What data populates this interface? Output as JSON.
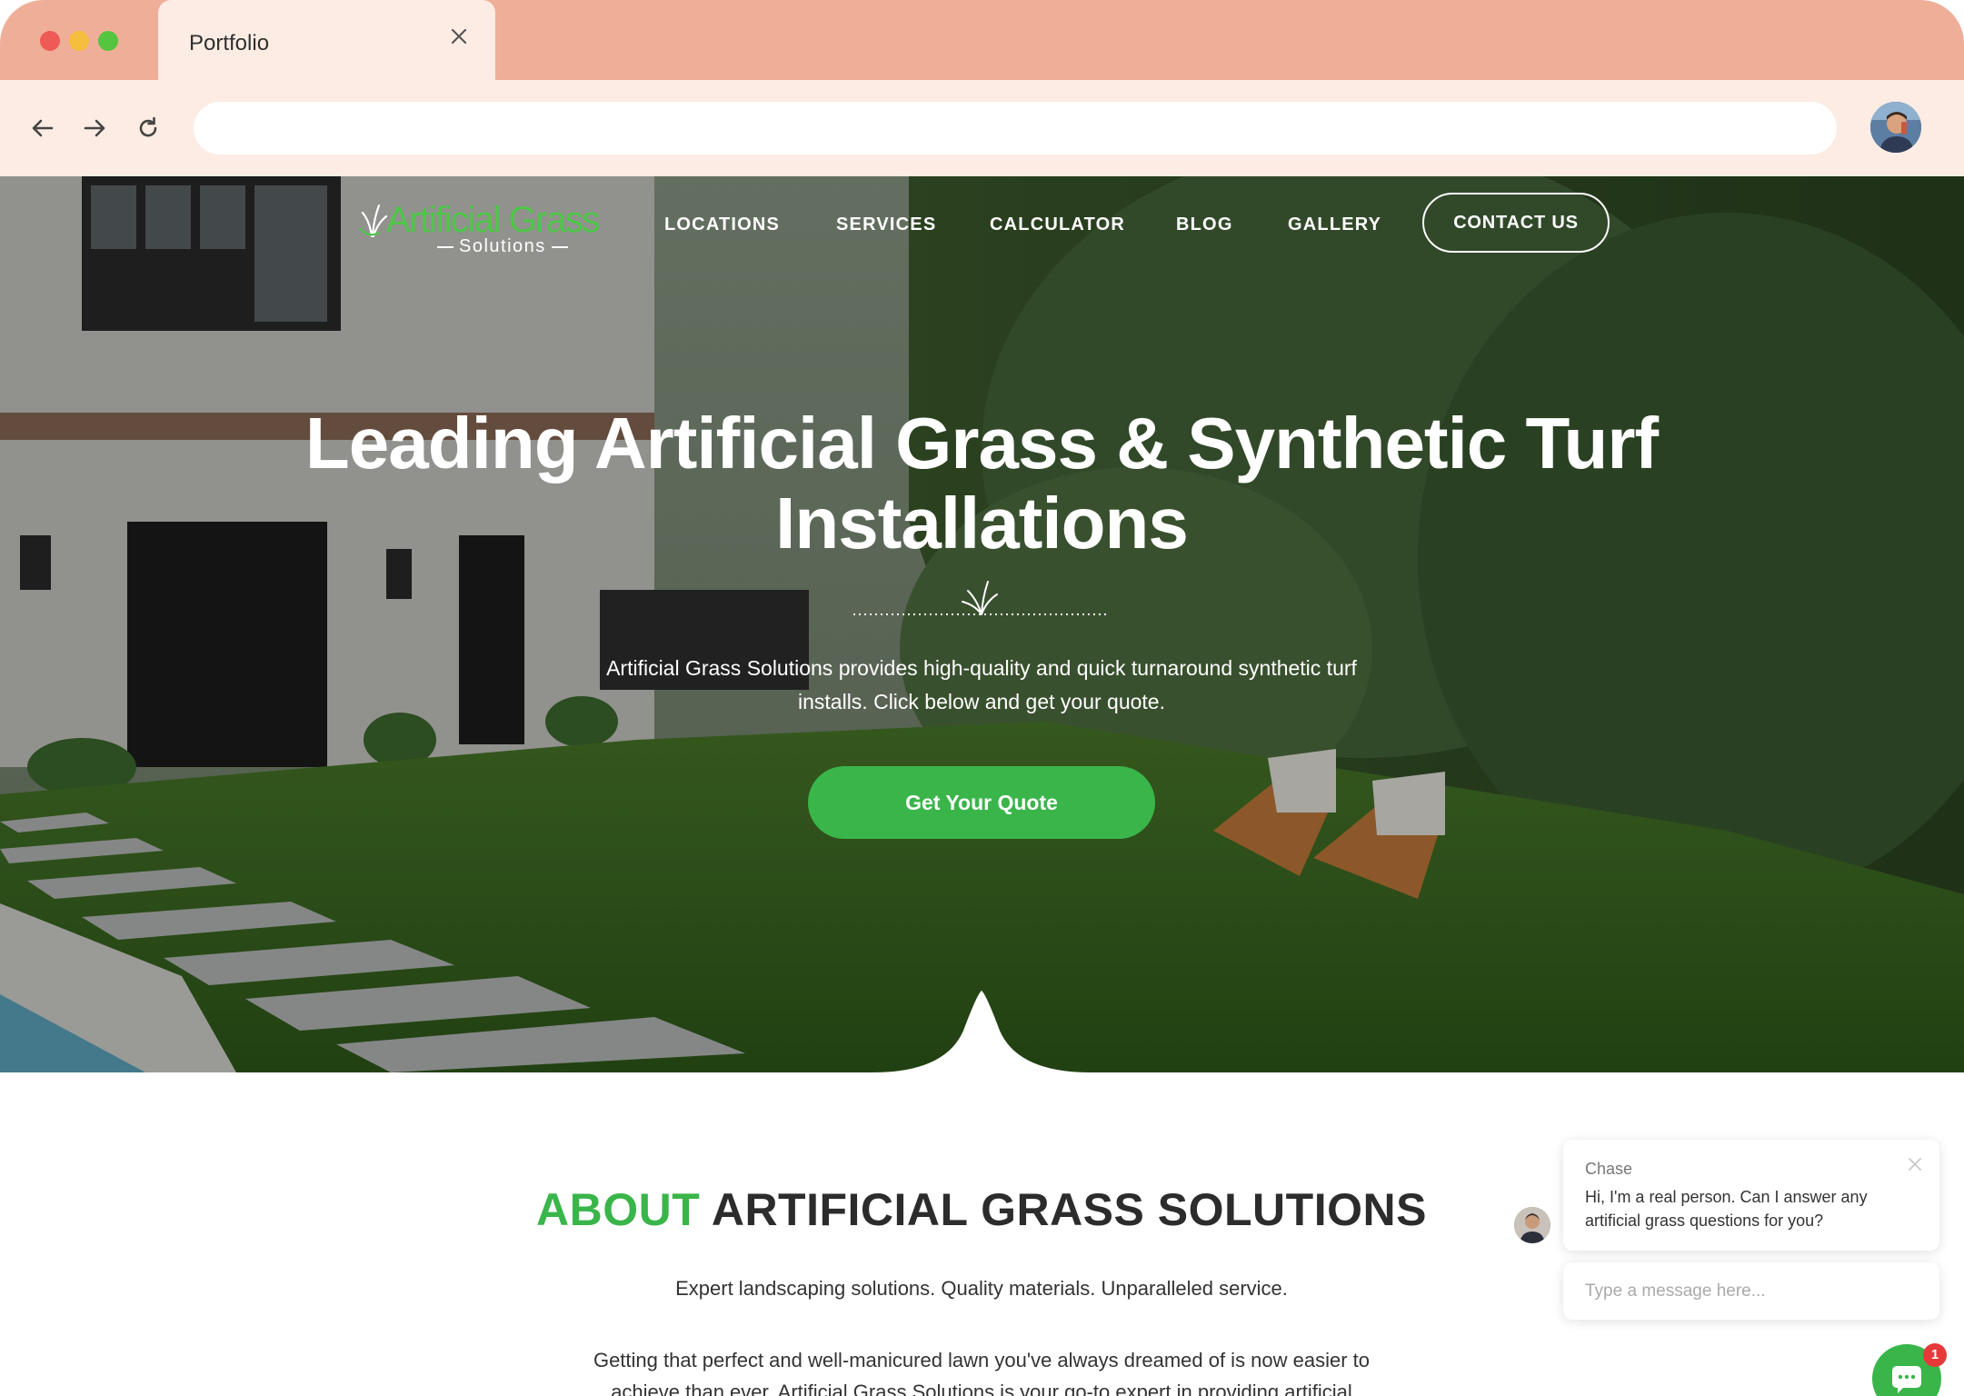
{
  "browser": {
    "tab_title": "Portfolio",
    "url": "",
    "colors": {
      "chrome_bar": "#efae97",
      "toolbar": "#fcece3"
    }
  },
  "site": {
    "logo": {
      "name": "Artificial Grass",
      "sub": "Solutions"
    },
    "nav": {
      "locations": "LOCATIONS",
      "services": "SERVICES",
      "calculator": "CALCULATOR",
      "blog": "BLOG",
      "gallery": "GALLERY",
      "contact": "CONTACT US"
    },
    "hero": {
      "title": "Leading Artificial Grass & Synthetic Turf Installations",
      "description": "Artificial Grass Solutions provides high-quality and quick turnaround synthetic turf installs. Click below and get your quote.",
      "cta": "Get Your Quote"
    },
    "about": {
      "title_accent": "ABOUT",
      "title_rest": "ARTIFICIAL GRASS SOLUTIONS",
      "tagline": "Expert landscaping solutions. Quality materials. Unparalleled service.",
      "body": "Getting that perfect and well-manicured lawn you've always dreamed of is now easier to achieve than ever. Artificial Grass Solutions is your go-to expert in providing artificial"
    },
    "colors": {
      "accent": "#3ab54a",
      "text": "#2c2c2c"
    }
  },
  "chat": {
    "agent_name": "Chase",
    "message": "Hi, I'm a real person. Can I answer any artificial grass questions for you?",
    "input_placeholder": "Type a message here...",
    "badge_count": "1"
  }
}
